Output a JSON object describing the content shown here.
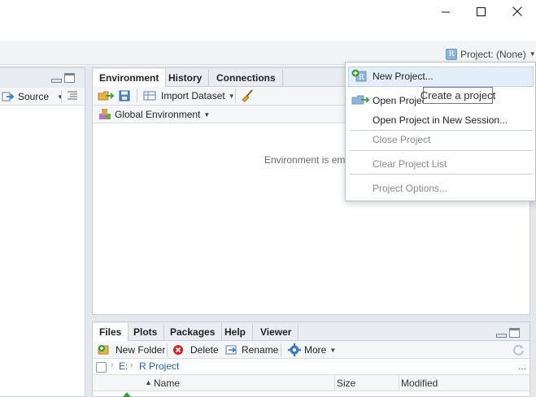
{
  "window": {
    "controls": [
      "minimize-icon",
      "maximize-icon",
      "close-icon"
    ]
  },
  "toolbar": {
    "project_label": "Project: (None)",
    "project_icon_letter": "R"
  },
  "source_pane": {
    "source_label": "Source"
  },
  "environment_pane": {
    "tabs": [
      "Environment",
      "History",
      "Connections"
    ],
    "active_tab": "Environment",
    "import_dataset_label": "Import Dataset",
    "global_env_label": "Global Environment",
    "empty_message": "Environment is em"
  },
  "files_pane": {
    "tabs": [
      "Files",
      "Plots",
      "Packages",
      "Help",
      "Viewer"
    ],
    "active_tab": "Files",
    "toolbar": {
      "new_folder": "New Folder",
      "delete": "Delete",
      "rename": "Rename",
      "more": "More"
    },
    "breadcrumb": [
      "E:",
      "R Project"
    ],
    "ellipsis": "...",
    "columns": [
      "Name",
      "Size",
      "Modified"
    ]
  },
  "project_menu": {
    "items": [
      {
        "label": "New Project...",
        "enabled": true,
        "highlighted": true
      },
      {
        "label": "Open Project...",
        "enabled": true
      },
      {
        "label": "Open Project in New Session...",
        "enabled": true
      },
      {
        "label": "Close Project",
        "enabled": false
      },
      {
        "label": "Clear Project List",
        "enabled": false
      },
      {
        "label": "Project Options...",
        "enabled": false
      }
    ],
    "tooltip": "Create a project"
  },
  "colors": {
    "accent_blue": "#2a5db0",
    "menu_highlight": "#e3eef9",
    "disabled_text": "#8a8a8a"
  }
}
